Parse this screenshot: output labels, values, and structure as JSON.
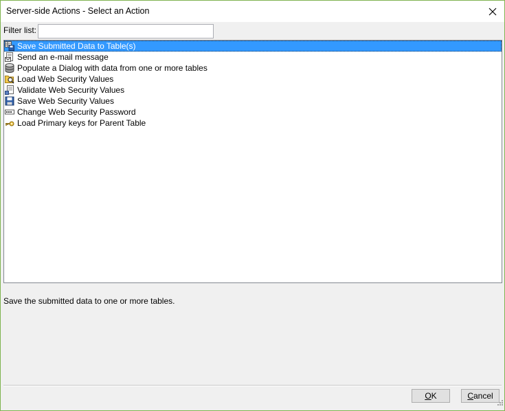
{
  "window": {
    "title": "Server-side Actions - Select an Action"
  },
  "filter": {
    "label": "Filter list:",
    "value": "",
    "placeholder": ""
  },
  "actions": [
    {
      "label": "Save Submitted Data to Table(s)",
      "icon": "save-table-icon",
      "selected": true
    },
    {
      "label": "Send an e-mail message",
      "icon": "email-icon",
      "selected": false
    },
    {
      "label": "Populate a Dialog with data from one or more tables",
      "icon": "database-icon",
      "selected": false
    },
    {
      "label": "Load Web Security Values",
      "icon": "folder-magnifier-icon",
      "selected": false
    },
    {
      "label": "Validate Web Security Values",
      "icon": "document-check-icon",
      "selected": false
    },
    {
      "label": "Save Web Security Values",
      "icon": "floppy-disk-icon",
      "selected": false
    },
    {
      "label": "Change Web Security Password",
      "icon": "password-field-icon",
      "selected": false
    },
    {
      "label": "Load Primary keys for Parent Table",
      "icon": "key-icon",
      "selected": false
    }
  ],
  "description": "Save the submitted data to one or more tables.",
  "buttons": {
    "ok": {
      "mnemonic": "O",
      "rest": "K"
    },
    "cancel": {
      "mnemonic": "C",
      "rest": "ancel"
    }
  },
  "colors": {
    "selection": "#3399ff",
    "window_border": "#7fb34f",
    "dialog_background": "#f0f0f0"
  }
}
